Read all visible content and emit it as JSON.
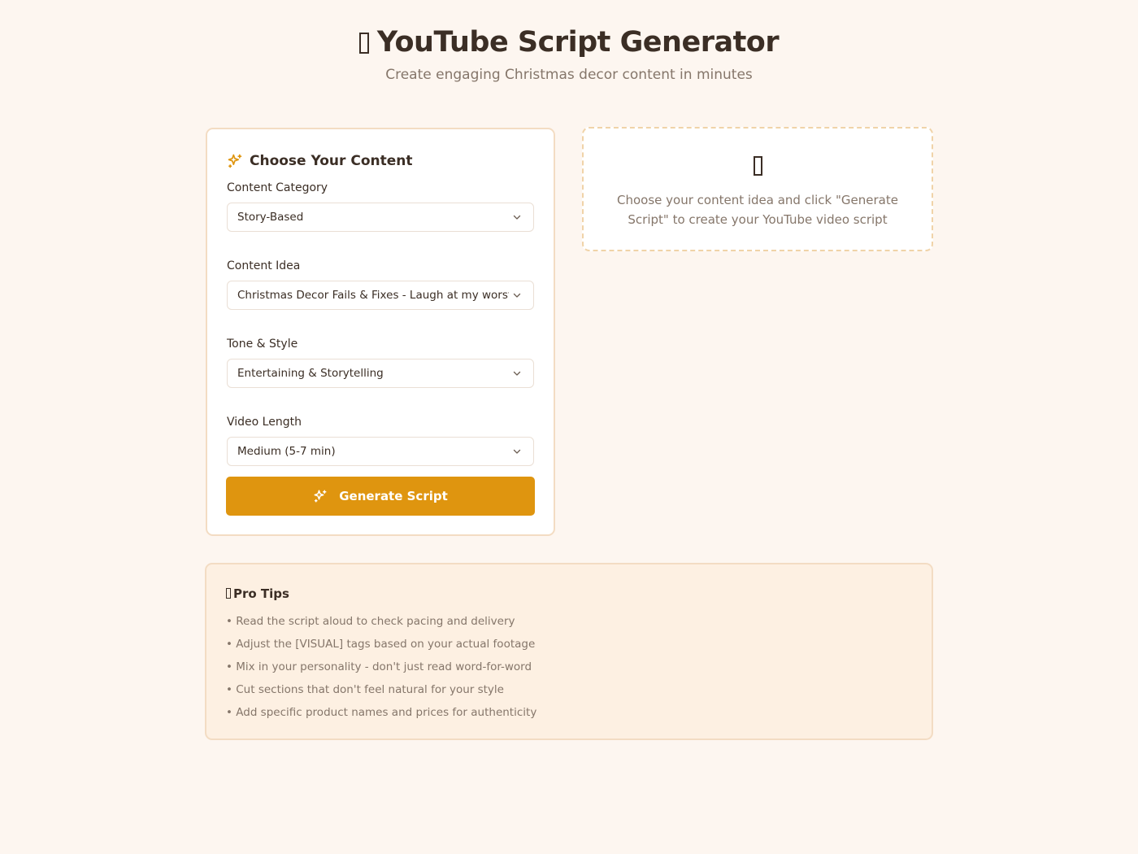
{
  "header": {
    "title": "YouTube Script Generator",
    "subtitle": "Create engaging Christmas decor content in minutes"
  },
  "form": {
    "heading": "Choose Your Content",
    "fields": [
      {
        "label": "Content Category",
        "value": "Story-Based"
      },
      {
        "label": "Content Idea",
        "value": "Christmas Decor Fails & Fixes - Laugh at my worst attempts"
      },
      {
        "label": "Tone & Style",
        "value": "Entertaining & Storytelling"
      },
      {
        "label": "Video Length",
        "value": "Medium (5-7 min)"
      }
    ],
    "generate_label": "Generate Script"
  },
  "output": {
    "placeholder": "Choose your content idea and click \"Generate Script\" to create your YouTube video script"
  },
  "tips": {
    "title": "Pro Tips",
    "items": [
      "• Read the script aloud to check pacing and delivery",
      "• Adjust the [VISUAL] tags based on your actual footage",
      "• Mix in your personality - don't just read word-for-word",
      "• Cut sections that don't feel natural for your style",
      "• Add specific product names and prices for authenticity"
    ]
  },
  "colors": {
    "accent": "#df950f",
    "background": "#fdf6f0",
    "tips_background": "#fdf0e2",
    "border": "#f3dcc3"
  },
  "icons": {
    "title": "missing-glyph-icon",
    "form_heading": "sparkles-icon",
    "generate": "sparkles-icon",
    "placeholder": "missing-glyph-icon",
    "tips": "missing-glyph-icon"
  }
}
